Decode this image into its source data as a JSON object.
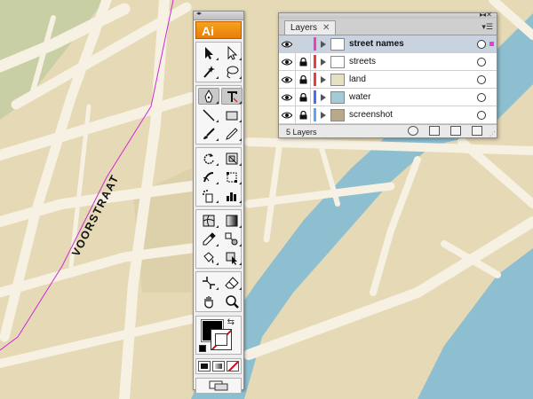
{
  "map": {
    "street_label": "VOORSTRAAT",
    "colors": {
      "land": "#e5d9b6",
      "land_green": "#c9cfa4",
      "street": "#f6f1e3",
      "water": "#8dbfd0",
      "street_names_line": "#d02ad6"
    }
  },
  "tools_panel": {
    "logo": "Ai",
    "collapse_icon": "double-chevron-icon",
    "tools": [
      "selection-arrow-icon",
      "direct-selection-arrow-icon",
      "magic-wand-icon",
      "lasso-icon",
      "pen-icon",
      "type-icon",
      "line-icon",
      "rectangle-icon",
      "paintbrush-icon",
      "pencil-icon",
      "rotate-icon",
      "scale-icon",
      "warp-icon",
      "free-transform-icon",
      "symbol-sprayer-icon",
      "column-graph-icon",
      "mesh-icon",
      "gradient-icon",
      "eyedropper-icon",
      "blend-icon",
      "live-paint-bucket-icon",
      "live-paint-selection-icon",
      "slice-icon",
      "eraser-icon",
      "hand-icon",
      "zoom-icon"
    ],
    "fill_color": "#000000",
    "stroke": "none"
  },
  "layers_panel": {
    "tab_label": "Layers",
    "close_symbol": "✕",
    "layer_count": "5 Layers",
    "layers": [
      {
        "name": "street names",
        "color": "#ef3cc8",
        "locked": false,
        "selected": true,
        "thumb": "#ffffff"
      },
      {
        "name": "streets",
        "color": "#ef3a3a",
        "locked": true,
        "selected": false,
        "thumb": "#ffffff"
      },
      {
        "name": "land",
        "color": "#ef3a3a",
        "locked": true,
        "selected": false,
        "thumb": "#e6e0c2"
      },
      {
        "name": "water",
        "color": "#4e6cf0",
        "locked": true,
        "selected": false,
        "thumb": "#a4cad6"
      },
      {
        "name": "screenshot",
        "color": "#5ea6f2",
        "locked": true,
        "selected": false,
        "thumb": "#b7a98a"
      }
    ]
  }
}
